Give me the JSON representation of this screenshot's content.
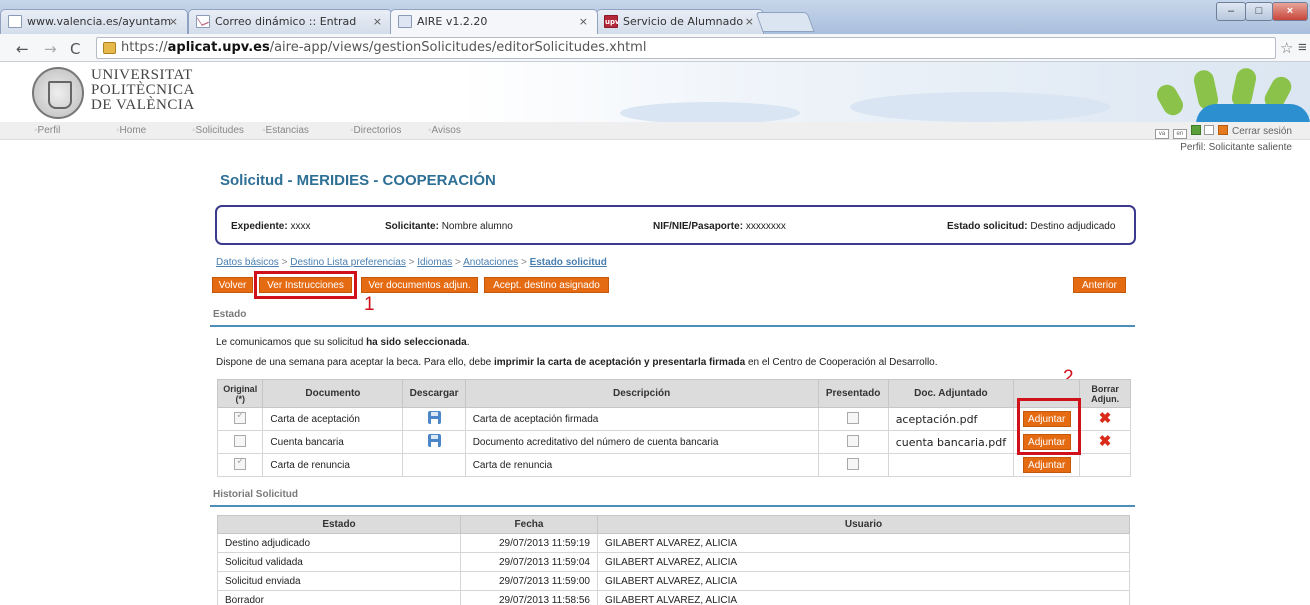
{
  "browser": {
    "tabs": [
      {
        "title": "www.valencia.es/ayuntam",
        "icon": "page-icon"
      },
      {
        "title": "Correo dinámico :: Entrad",
        "icon": "mail-icon"
      },
      {
        "title": "AIRE v1.2.20",
        "icon": "aire-icon",
        "active": true
      },
      {
        "title": "Servicio de Alumnado",
        "icon": "upv-icon"
      }
    ],
    "url_scheme": "https://",
    "url_host": "aplicat.upv.es",
    "url_path": "/aire-app/views/gestionSolicitudes/editorSolicitudes.xhtml",
    "close_glyph": "×",
    "upv_favicon_text": "upv"
  },
  "university": {
    "line1": "UNIVERSITAT",
    "line2": "POLITÈCNICA",
    "line3": "DE VALÈNCIA"
  },
  "nav": {
    "items": [
      "Perfil",
      "Home",
      "Solicitudes",
      "Estancias",
      "Directorios",
      "Avisos"
    ],
    "lang1": "va",
    "lang2": "en",
    "logout": "Cerrar sesión"
  },
  "profile_label": "Perfil: Solicitante saliente",
  "page_title": "Solicitud - MERIDIES - COOPERACIÓN",
  "info": {
    "expediente_label": "Expediente:",
    "expediente_value": "xxxx",
    "solicitante_label": "Solicitante:",
    "solicitante_value": "Nombre alumno",
    "nif_label": "NIF/NIE/Pasaporte:",
    "nif_value": "xxxxxxxx",
    "estado_label": "Estado solicitud:",
    "estado_value": "Destino adjudicado"
  },
  "breadcrumbs": {
    "items": [
      "Datos básicos",
      "Destino Lista preferencias",
      "Idiomas",
      "Anotaciones",
      "Estado solicitud"
    ],
    "separator": ">"
  },
  "buttons": {
    "volver": "Volver",
    "instrucciones": "Ver Instrucciones",
    "documentos": "Ver documentos adjun.",
    "aceptar": "Acept. destino asignado",
    "anterior": "Anterior"
  },
  "callouts": {
    "one": "1",
    "two": "2"
  },
  "estado_section": {
    "title": "Estado",
    "msg1_prefix": "Le comunicamos que su solicitud ",
    "msg1_bold": "ha sido seleccionada",
    "msg1_suffix": ".",
    "msg2_prefix": "Dispone de una semana para aceptar la beca. Para ello, debe ",
    "msg2_bold": "imprimir la carta de aceptación y presentarla firmada",
    "msg2_suffix": " en el Centro de Cooperación al Desarrollo."
  },
  "docs_table": {
    "headers": {
      "original": "Original (*)",
      "documento": "Documento",
      "descargar": "Descargar",
      "descripcion": "Descripción",
      "presentado": "Presentado",
      "adjuntado": "Doc. Adjuntado",
      "adjuntar": "",
      "borrar": "Borrar Adjun."
    },
    "rows": [
      {
        "original": true,
        "documento": "Carta de aceptación",
        "descargar": true,
        "descripcion": "Carta de aceptación firmada",
        "presentado": false,
        "adjuntado": "aceptación.pdf",
        "button": "Adjuntar",
        "borrar": true
      },
      {
        "original": false,
        "documento": "Cuenta bancaria",
        "descargar": true,
        "descripcion": "Documento acreditativo del número de cuenta bancaria",
        "presentado": false,
        "adjuntado": "cuenta bancaria.pdf",
        "button": "Adjuntar",
        "borrar": true
      },
      {
        "original": true,
        "documento": "Carta de renuncia",
        "descargar": false,
        "descripcion": "Carta de renuncia",
        "presentado": false,
        "adjuntado": "",
        "button": "Adjuntar",
        "borrar": false
      }
    ]
  },
  "historial": {
    "title": "Historial Solicitud",
    "headers": {
      "estado": "Estado",
      "fecha": "Fecha",
      "usuario": "Usuario"
    },
    "rows": [
      {
        "estado": "Destino adjudicado",
        "fecha": "29/07/2013 11:59:19",
        "usuario": "GILABERT ALVAREZ, ALICIA"
      },
      {
        "estado": "Solicitud validada",
        "fecha": "29/07/2013 11:59:04",
        "usuario": "GILABERT ALVAREZ, ALICIA"
      },
      {
        "estado": "Solicitud enviada",
        "fecha": "29/07/2013 11:59:00",
        "usuario": "GILABERT ALVAREZ, ALICIA"
      },
      {
        "estado": "Borrador",
        "fecha": "29/07/2013 11:58:56",
        "usuario": "GILABERT ALVAREZ, ALICIA"
      }
    ]
  },
  "colors": {
    "accent_orange": "#e56b13",
    "title_blue": "#2e6f96",
    "highlight_red": "#d0101a"
  }
}
